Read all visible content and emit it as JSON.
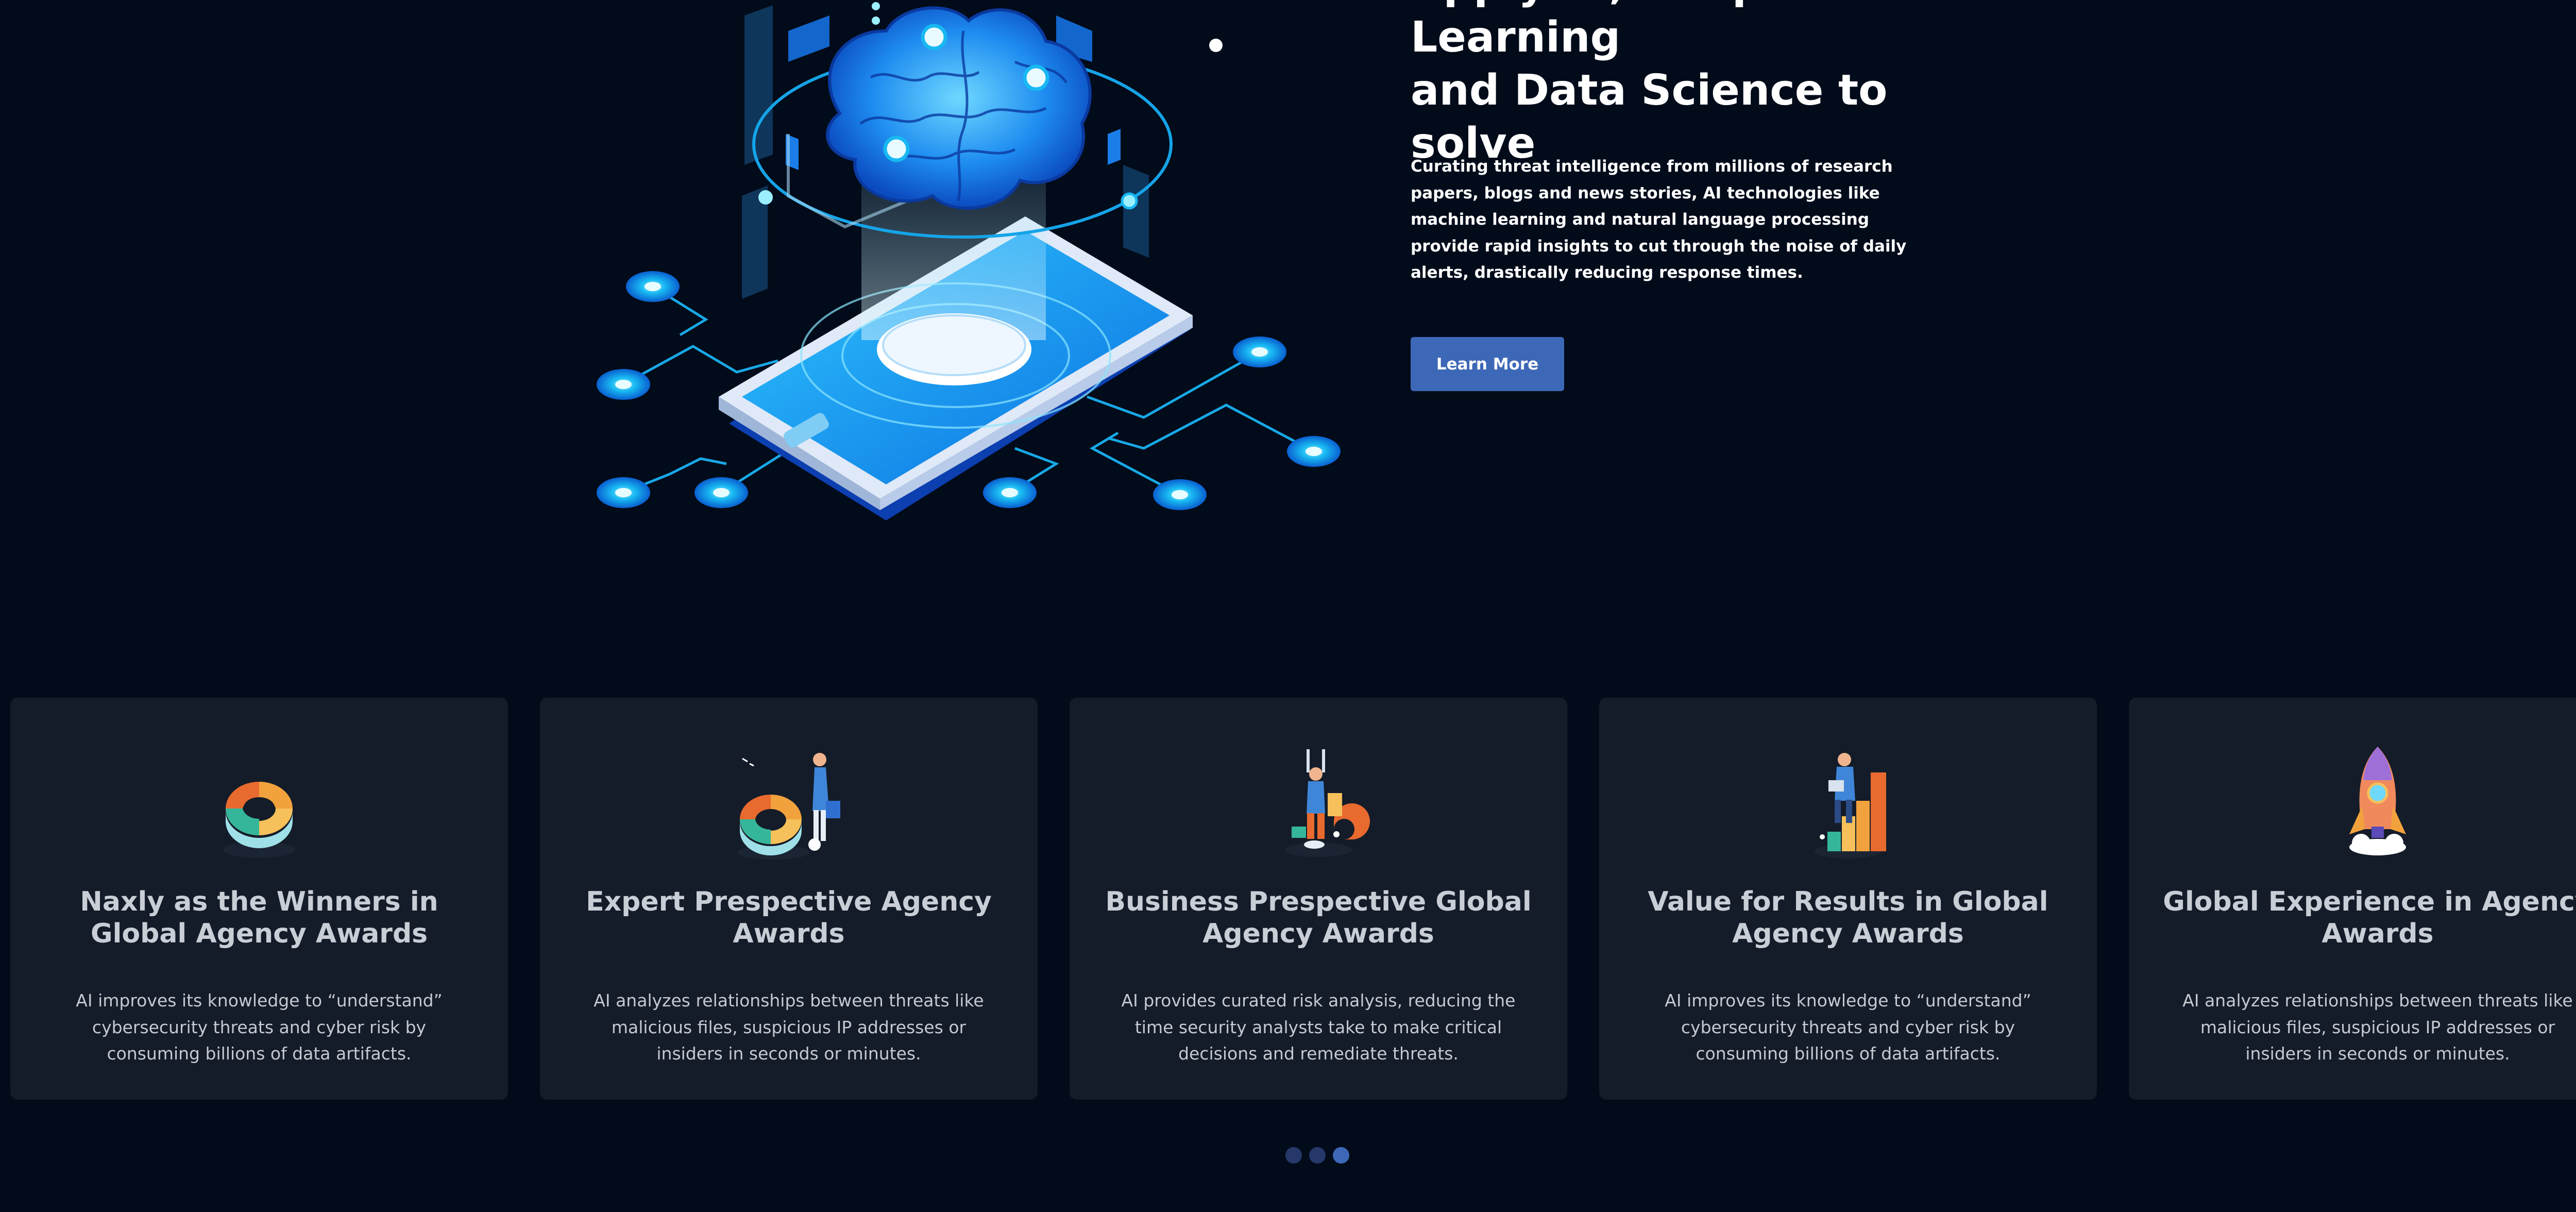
{
  "hero": {
    "title_lines": [
      "Apply AI, Deep Learning",
      "and Data Science to",
      "solve"
    ],
    "description": "Curating threat intelligence from millions of research papers, blogs and news stories, AI technologies like machine learning and natural language processing provide rapid insights to cut through the noise of daily alerts, drastically reducing response times.",
    "button_label": "Learn More",
    "illustration_icon": "ai-brain-phone-icon"
  },
  "cards": [
    {
      "icon": "donut-chart-icon",
      "title": "Naxly as the Winners in Global Agency Awards",
      "description": "AI improves its knowledge to “understand” cybersecurity threats and cyber risk by consuming billions of data artifacts."
    },
    {
      "icon": "analyst-donut-chart-icon",
      "title": "Expert Prespective Agency Awards",
      "description": "AI analyzes relationships between threats like malicious files, suspicious IP addresses or insiders in seconds or minutes."
    },
    {
      "icon": "person-chart-icon",
      "title": "Business Prespective Global Agency Awards",
      "description": "AI provides curated risk analysis, reducing the time security analysts take to make critical decisions and remediate threats."
    },
    {
      "icon": "bar-chart-person-icon",
      "title": "Value for Results in Global Agency Awards",
      "description": "AI improves its knowledge to “understand” cybersecurity threats and cyber risk by consuming billions of data artifacts."
    },
    {
      "icon": "rocket-icon",
      "title": "Global Experience in Agency Awards",
      "description": "AI analyzes relationships between threats like malicious files, suspicious IP addresses or insiders in seconds or minutes."
    }
  ],
  "carousel": {
    "page_count": 3,
    "active_page": 3
  },
  "colors": {
    "background": "#020b1a",
    "card": "#141c29",
    "accent": "#3d68b7",
    "glow": "#14b6f0"
  }
}
